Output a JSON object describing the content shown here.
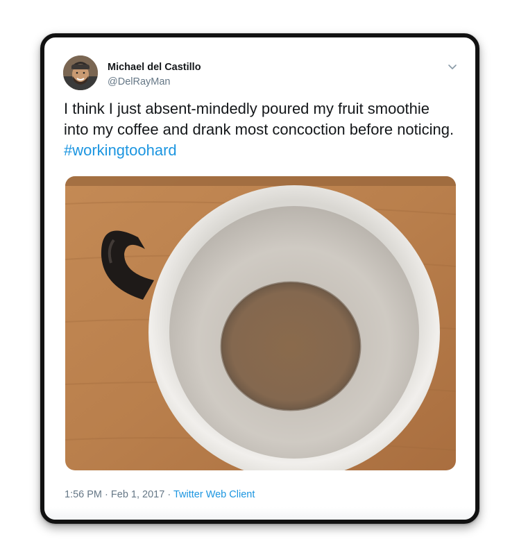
{
  "tweet": {
    "author_name": "Michael del Castillo",
    "author_handle": "@DelRayMan",
    "text": "I think I just absent-mindedly poured my fruit smoothie into my coffee and drank most concoction before noticing.",
    "hashtag": "#workingtoohard",
    "time": "1:56 PM",
    "date": "Feb 1, 2017",
    "separator": "·",
    "source": "Twitter Web Client",
    "more_icon": "chevron-down-icon"
  },
  "colors": {
    "text": "#14171a",
    "secondary": "#657786",
    "link": "#1b95e0",
    "frame": "#111111"
  }
}
